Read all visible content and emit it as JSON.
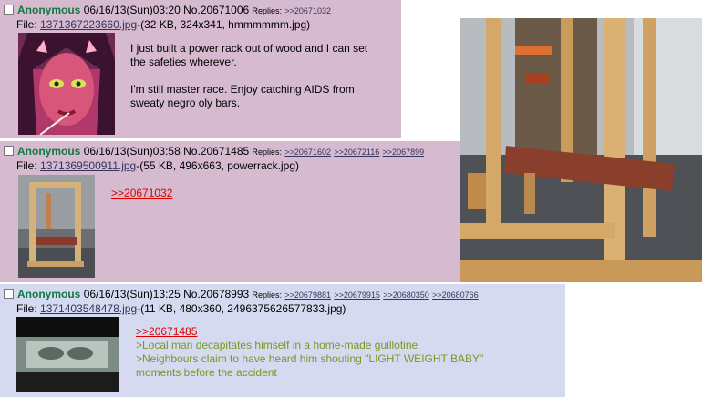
{
  "posts": [
    {
      "name": "Anonymous",
      "datetime": "06/16/13(Sun)03:20",
      "number": "No.20671006",
      "replies_label": "Replies:",
      "replies": [
        ">>20671032"
      ],
      "file_label": "File:",
      "filename": "1371367223660.jpg",
      "fileinfo": "-(32 KB, 324x341, hmmmmmm.jpg)",
      "message_lines": [
        "I just built a power rack out of wood and I can set",
        "the safeties wherever.",
        "",
        "I'm still master race. Enjoy catching AIDS from",
        "sweaty negro oly bars."
      ]
    },
    {
      "name": "Anonymous",
      "datetime": "06/16/13(Sun)03:58",
      "number": "No.20671485",
      "replies_label": "Replies:",
      "replies": [
        ">>20671602",
        ">>20672116",
        ">>2067899"
      ],
      "file_label": "File:",
      "filename": "1371369500911.jpg",
      "fileinfo": "-(55 KB, 496x663, powerrack.jpg)",
      "quote": ">>20671032"
    },
    {
      "name": "Anonymous",
      "datetime": "06/16/13(Sun)13:25",
      "number": "No.20678993",
      "replies_label": "Replies:",
      "replies": [
        ">>20679881",
        ">>20679915",
        ">>20680350",
        ">>20680766"
      ],
      "file_label": "File:",
      "filename": "1371403548478.jpg",
      "fileinfo": "-(11 KB, 480x360, 2496375626577833.jpg)",
      "quote": ">>20671485",
      "greentext": [
        ">Local man decapitates himself in a home-made guillotine",
        ">Neighbours claim to have heard him shouting \"LIGHT WEIGHT BABY\"",
        "moments before the accident"
      ]
    }
  ],
  "colors": {
    "post_bg_nws": "#d6bad0",
    "post_bg_sfw": "#d6daf0",
    "name": "#117743",
    "link": "#34345c",
    "quote": "#dd0000",
    "greentext": "#789922"
  }
}
